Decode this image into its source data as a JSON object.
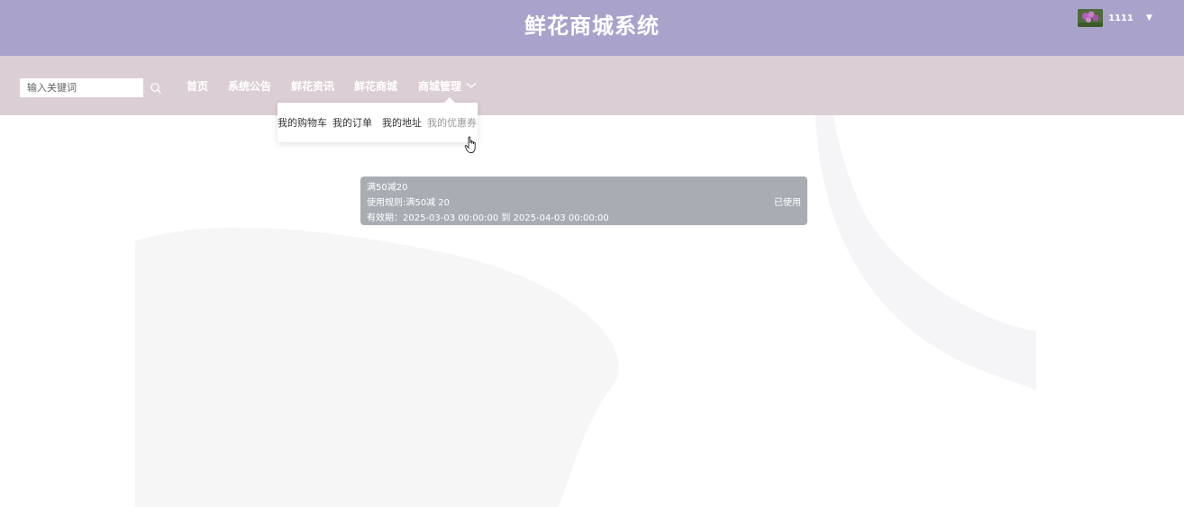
{
  "header": {
    "title": "鲜花商城系统",
    "username": "1111"
  },
  "search": {
    "placeholder": "输入关键词"
  },
  "nav": {
    "items": [
      "首页",
      "系统公告",
      "鲜花资讯",
      "鲜花商城",
      "商城管理"
    ]
  },
  "dropdown": {
    "items": [
      "我的购物车",
      "我的订单",
      "我的地址",
      "我的优惠券"
    ],
    "active": "我的优惠券"
  },
  "coupon": {
    "name": "满50减20",
    "rule": "使用规则:满50减 20",
    "validity": "有效期：2025-03-03 00:00:00 到 2025-04-03 00:00:00",
    "status": "已使用"
  },
  "colors": {
    "header_bg": "#a9a3cc",
    "nav_bg": "#dbcfd5",
    "coupon_used_bg": "#a8adb3"
  }
}
